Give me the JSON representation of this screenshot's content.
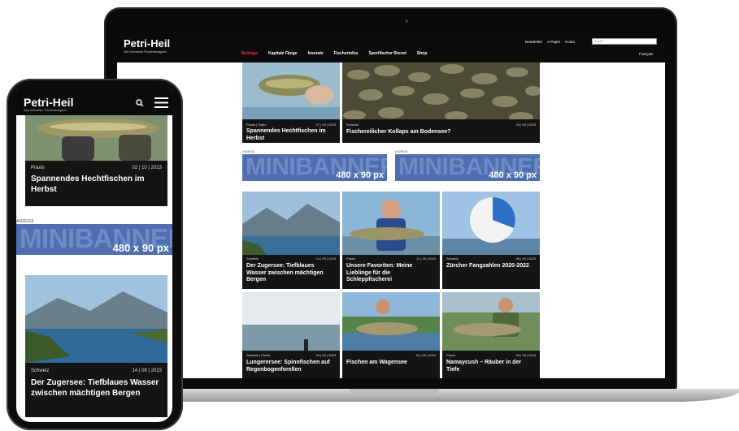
{
  "site": {
    "logo": "Petri-Heil",
    "tagline": "Dein Schweizer Fischereimagazin"
  },
  "laptop": {
    "nav": [
      "Beiträge",
      "Kapitale Fänge",
      "Inserate",
      "Fischerinfos",
      "Sportfischer Brevet",
      "Shop"
    ],
    "util": [
      "Newsletter",
      "e-Paper",
      "Konto"
    ],
    "search_placeholder": "Suche",
    "language": "Français",
    "cards": [
      {
        "category": "Praxis | Video",
        "date": "27 | 09 | 2023",
        "title": "Spannendes Hechtfischen im Herbst"
      },
      {
        "category": "Schweiz",
        "date": "25 | 09 | 2023",
        "title": "Fischereilicher Kollaps am Bodensee?"
      },
      {
        "category": "Schweiz",
        "date": "14 | 09 | 2023",
        "title": "Der Zugersee: Tiefblaues Wasser zwischen mächtigen Bergen"
      },
      {
        "category": "Praxis",
        "date": "11 | 09 | 2023",
        "title": "Unsere Favoriten: Meine Lieblinge für die Schleppfischerei"
      },
      {
        "category": "Schweiz",
        "date": "08 | 09 | 2023",
        "title": "Zürcher Fangzahlen 2020-2022"
      },
      {
        "category": "Schweiz | Praxis",
        "date": "06 | 09 | 2023",
        "title": "Lungerersee: Spinnfischen auf Regenbogenforellen"
      },
      {
        "category": "",
        "date": "01 | 09 | 2023",
        "title": "Fischen am Wagensee"
      },
      {
        "category": "Praxis",
        "date": "28 | 08 | 2023",
        "title": "Namaycush – Räuber in der Tiefe"
      }
    ],
    "banners": [
      {
        "label": "ANZEIGE",
        "word": "MINIBANNER",
        "size": "480 x 90 px"
      },
      {
        "label": "ANZEIGE",
        "word": "MINIBANNER",
        "size": "480 x 90 px"
      }
    ]
  },
  "phone": {
    "cards": [
      {
        "category": "Praxis",
        "date": "02 | 10 | 2023",
        "title": "Spannendes Hechtfischen im Herbst"
      },
      {
        "category": "Schweiz",
        "date": "14 | 09 | 2023",
        "title": "Der Zugersee: Tiefblaues Wasser zwischen mächtigen Bergen"
      }
    ],
    "banner": {
      "label": "ANZEIGE",
      "word": "MINIBANNER",
      "size": "480 x 90 px"
    }
  },
  "colors": {
    "accent": "#e03b2b",
    "banner": "#4e6eb0",
    "header": "#0b0b0b"
  }
}
